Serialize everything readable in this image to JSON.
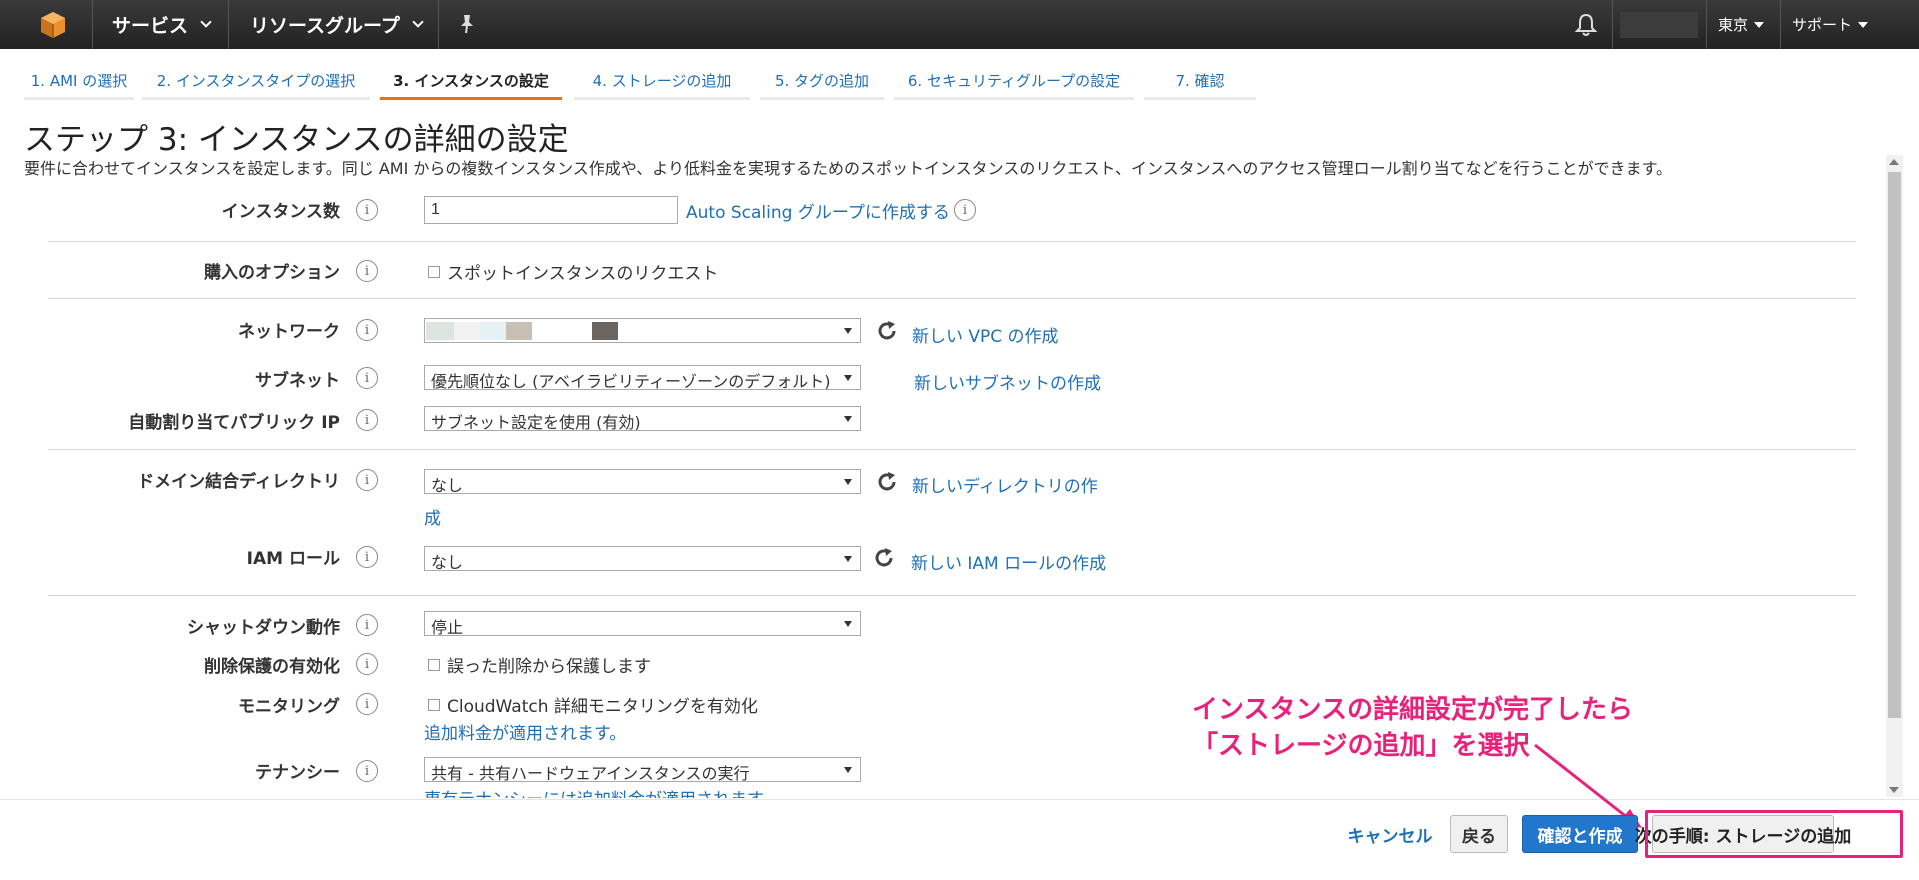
{
  "topbar": {
    "services": "サービス",
    "resource_groups": "リソースグループ",
    "region": "東京",
    "support": "サポート"
  },
  "tabs": [
    {
      "label": "1. AMI の選択"
    },
    {
      "label": "2. インスタンスタイプの選択"
    },
    {
      "label": "3. インスタンスの設定"
    },
    {
      "label": "4. ストレージの追加"
    },
    {
      "label": "5. タグの追加"
    },
    {
      "label": "6. セキュリティグループの設定"
    },
    {
      "label": "7. 確認"
    }
  ],
  "page": {
    "title": "ステップ 3: インスタンスの詳細の設定",
    "description": "要件に合わせてインスタンスを設定します。同じ AMI からの複数インスタンス作成や、より低料金を実現するためのスポットインスタンスのリクエスト、インスタンスへのアクセス管理ロール割り当てなどを行うことができます。"
  },
  "form": {
    "instance_count": {
      "label": "インスタンス数",
      "value": "1",
      "link": "Auto Scaling グループに作成する"
    },
    "purchase_option": {
      "label": "購入のオプション",
      "checkbox": "スポットインスタンスのリクエスト"
    },
    "network": {
      "label": "ネットワーク",
      "link": "新しい VPC の作成"
    },
    "subnet": {
      "label": "サブネット",
      "value": "優先順位なし (アベイラビリティーゾーンのデフォルト)",
      "link": "新しいサブネットの作成"
    },
    "public_ip": {
      "label": "自動割り当てパブリック IP",
      "value": "サブネット設定を使用 (有効)"
    },
    "domain": {
      "label": "ドメイン結合ディレクトリ",
      "value": "なし",
      "link_line1": "新しいディレクトリの作",
      "link_line2": "成"
    },
    "iam": {
      "label": "IAM ロール",
      "value": "なし",
      "link": "新しい IAM ロールの作成"
    },
    "shutdown": {
      "label": "シャットダウン動作",
      "value": "停止"
    },
    "termination": {
      "label": "削除保護の有効化",
      "checkbox": "誤った削除から保護します"
    },
    "monitoring": {
      "label": "モニタリング",
      "checkbox": "CloudWatch 詳細モニタリングを有効化",
      "note": "追加料金が適用されます。"
    },
    "tenancy": {
      "label": "テナンシー",
      "value": "共有 - 共有ハードウェアインスタンスの実行",
      "note": "専有テナンシーには追加料金が適用されます。"
    }
  },
  "footer": {
    "cancel": "キャンセル",
    "back": "戻る",
    "review": "確認と作成",
    "next": "次の手順: ストレージの追加"
  },
  "annotation": {
    "line1": "インスタンスの詳細設定が完了したら",
    "line2": "「ストレージの追加」を選択"
  },
  "colors": {
    "accent_tab": "#ec7211",
    "link": "#1f6fb5",
    "primary_button": "#2277cc",
    "annotation": "#e8227a"
  }
}
